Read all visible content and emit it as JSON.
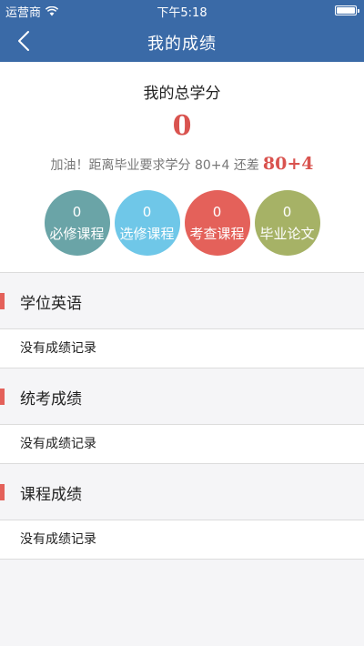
{
  "status_bar": {
    "carrier": "运营商",
    "time": "下午5:18"
  },
  "nav": {
    "title": "我的成绩"
  },
  "summary": {
    "label": "我的总学分",
    "total": "0",
    "tip": "加油！距离毕业要求学分 80+4 还差",
    "remaining": "80+4"
  },
  "categories": [
    {
      "value": "0",
      "label": "必修课程",
      "color": "#6aa4a7"
    },
    {
      "value": "0",
      "label": "选修课程",
      "color": "#6fc7e8"
    },
    {
      "value": "0",
      "label": "考查课程",
      "color": "#e4615a"
    },
    {
      "value": "0",
      "label": "毕业论文",
      "color": "#a6b266"
    }
  ],
  "sections": [
    {
      "title": "学位英语",
      "empty": "没有成绩记录"
    },
    {
      "title": "统考成绩",
      "empty": "没有成绩记录"
    },
    {
      "title": "课程成绩",
      "empty": "没有成绩记录"
    }
  ],
  "colors": {
    "header": "#3a6aa7",
    "accent": "#e4615a",
    "highlight": "#d9534f"
  }
}
